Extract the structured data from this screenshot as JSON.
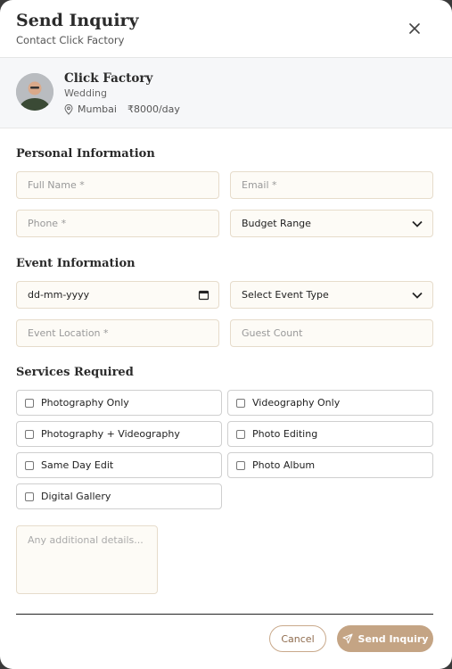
{
  "header": {
    "title": "Send Inquiry",
    "subtitle": "Contact Click Factory",
    "close_icon": "close-icon"
  },
  "vendor": {
    "name": "Click Factory",
    "category": "Wedding",
    "location": "Mumbai",
    "price": "₹8000/day",
    "location_icon": "map-pin-icon"
  },
  "personal": {
    "title": "Personal Information",
    "full_name_placeholder": "Full Name *",
    "email_placeholder": "Email *",
    "phone_placeholder": "Phone *",
    "budget_value": "Budget Range"
  },
  "event": {
    "title": "Event Information",
    "date_value": "dd-mm-yyyy",
    "event_type_value": "Select Event Type",
    "location_placeholder": "Event Location *",
    "guest_placeholder": "Guest Count"
  },
  "services": {
    "title": "Services Required",
    "items": [
      "Photography Only",
      "Videography Only",
      "Photography + Videography",
      "Photo Editing",
      "Same Day Edit",
      "Photo Album",
      "Digital Gallery"
    ]
  },
  "details_placeholder": "Any additional details...",
  "actions": {
    "cancel": "Cancel",
    "send": "Send Inquiry"
  },
  "colors": {
    "accent": "#c4a484",
    "field_bg": "#fdfbf6",
    "field_border": "#e6dccb"
  }
}
